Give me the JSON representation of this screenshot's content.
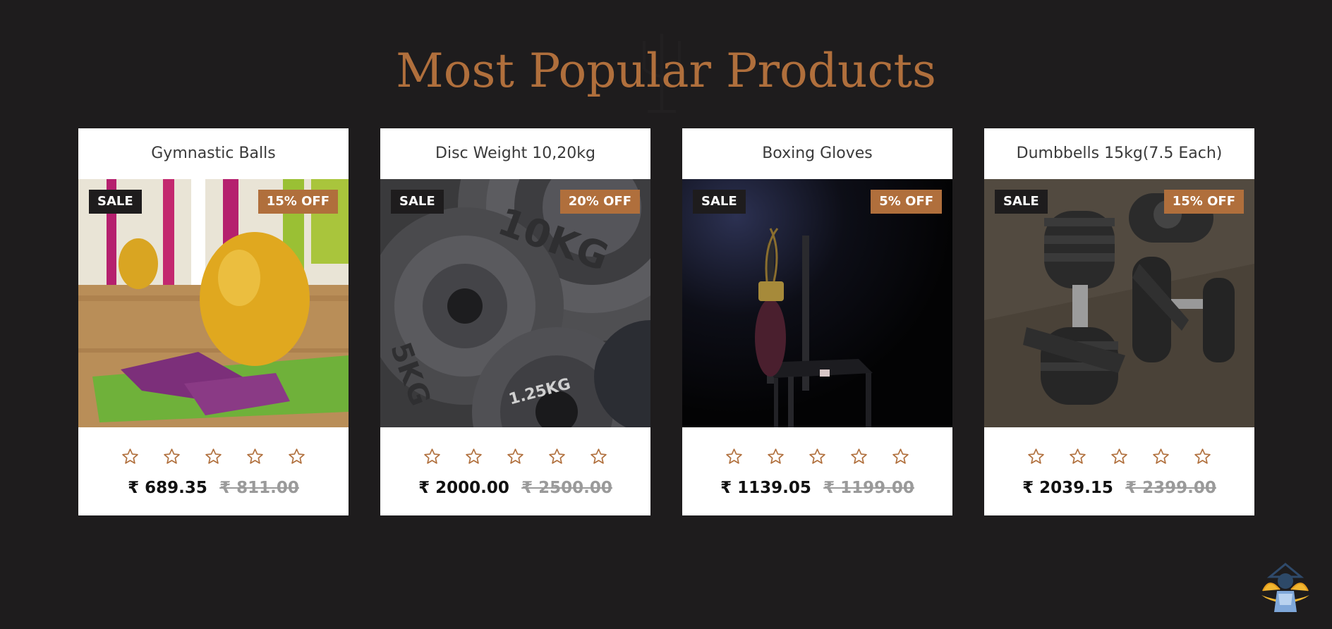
{
  "section": {
    "title": "Most Popular Products"
  },
  "products": [
    {
      "title": "Gymnastic Balls",
      "sale_badge": "SALE",
      "discount_badge": "15% OFF",
      "price": "₹ 689.35",
      "old_price": "₹ 811.00",
      "rating": 0,
      "image_icon": "gymnastic-ball-image"
    },
    {
      "title": "Disc Weight 10,20kg",
      "sale_badge": "SALE",
      "discount_badge": "20% OFF",
      "price": "₹ 2000.00",
      "old_price": "₹ 2500.00",
      "rating": 0,
      "image_icon": "disc-weight-image"
    },
    {
      "title": "Boxing Gloves",
      "sale_badge": "SALE",
      "discount_badge": "5% OFF",
      "price": "₹ 1139.05",
      "old_price": "₹ 1199.00",
      "rating": 0,
      "image_icon": "boxing-gloves-image"
    },
    {
      "title": "Dumbbells 15kg(7.5 Each)",
      "sale_badge": "SALE",
      "discount_badge": "15% OFF",
      "price": "₹ 2039.15",
      "old_price": "₹ 2399.00",
      "rating": 0,
      "image_icon": "dumbbells-image"
    }
  ],
  "colors": {
    "background": "#1e1c1d",
    "accent": "#b06f3c",
    "card": "#ffffff"
  },
  "back_to_top_icon": "strongman-icon"
}
